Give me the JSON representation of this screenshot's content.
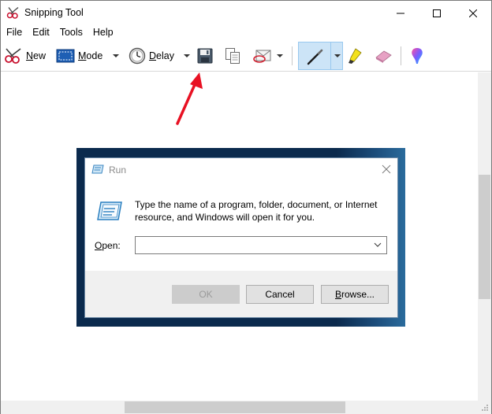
{
  "window": {
    "title": "Snipping Tool"
  },
  "menu": {
    "items": [
      "File",
      "Edit",
      "Tools",
      "Help"
    ]
  },
  "toolbar": {
    "new_prefix": "N",
    "new_rest": "ew",
    "mode_prefix": "M",
    "mode_rest": "ode",
    "delay_prefix": "D",
    "delay_rest": "elay"
  },
  "run_dialog": {
    "title": "Run",
    "description": "Type the name of a program, folder, document, or Internet resource, and Windows will open it for you.",
    "open_prefix": "O",
    "open_rest": "pen:",
    "open_value": "",
    "ok_label": "OK",
    "cancel_label": "Cancel",
    "browse_prefix": "B",
    "browse_rest": "rowse..."
  },
  "colors": {
    "accent": "#0078d7",
    "selected_tool_bg": "#cce4f7",
    "annotation_arrow": "#e81123",
    "desktop_bg": "#0b2a4d"
  },
  "icons": {
    "app": "scissors-icon",
    "new": "scissors-icon",
    "mode": "rectangle-mode-icon",
    "delay": "clock-icon",
    "save": "floppy-disk-icon",
    "copy": "copy-icon",
    "send": "envelope-icon",
    "pen": "pen-icon",
    "highlighter": "highlighter-icon",
    "eraser": "eraser-icon",
    "paint3d": "paint3d-icon"
  }
}
